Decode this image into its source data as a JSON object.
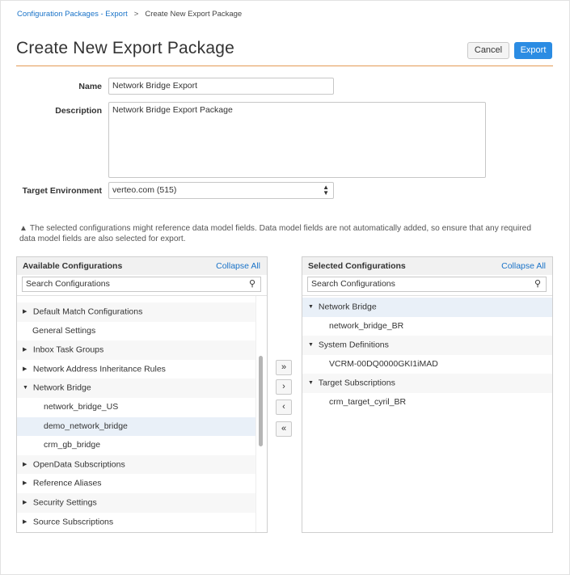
{
  "breadcrumb": {
    "parent": "Configuration Packages - Export",
    "separator": ">",
    "current": "Create New Export Package"
  },
  "page": {
    "title": "Create New Export Package"
  },
  "actions": {
    "cancel_label": "Cancel",
    "export_label": "Export"
  },
  "form": {
    "name_label": "Name",
    "name_value": "Network Bridge Export",
    "description_label": "Description",
    "description_value": "Network Bridge Export Package",
    "env_label": "Target Environment",
    "env_value": "verteo.com (515)"
  },
  "warning": {
    "icon": "warning-triangle-icon",
    "text": "The selected configurations might reference data model fields. Data model fields are not automatically added, so ensure that any required data model fields are also selected for export."
  },
  "available": {
    "title": "Available Configurations",
    "collapse_label": "Collapse All",
    "search_placeholder": "Search Configurations",
    "items": [
      {
        "label": "Default Match Configurations",
        "toggle": "▶",
        "level": 0
      },
      {
        "label": "General Settings",
        "toggle": "",
        "level": 0
      },
      {
        "label": "Inbox Task Groups",
        "toggle": "▶",
        "level": 0
      },
      {
        "label": "Network Address Inheritance Rules",
        "toggle": "▶",
        "level": 0
      },
      {
        "label": "Network Bridge",
        "toggle": "▼",
        "level": 0
      },
      {
        "label": "network_bridge_US",
        "toggle": "",
        "level": 1
      },
      {
        "label": "demo_network_bridge",
        "toggle": "",
        "level": 1,
        "selected": true
      },
      {
        "label": "crm_gb_bridge",
        "toggle": "",
        "level": 1
      },
      {
        "label": "OpenData Subscriptions",
        "toggle": "▶",
        "level": 0
      },
      {
        "label": "Reference Aliases",
        "toggle": "▶",
        "level": 0
      },
      {
        "label": "Security Settings",
        "toggle": "▶",
        "level": 0
      },
      {
        "label": "Source Subscriptions",
        "toggle": "▶",
        "level": 0
      }
    ]
  },
  "move_buttons": {
    "add_all": "»",
    "add": "›",
    "remove": "‹",
    "remove_all": "«"
  },
  "selected": {
    "title": "Selected Configurations",
    "collapse_label": "Collapse All",
    "search_placeholder": "Search Configurations",
    "items": [
      {
        "label": "Network Bridge",
        "toggle": "▼",
        "level": 0,
        "selected": true
      },
      {
        "label": "network_bridge_BR",
        "toggle": "",
        "level": 1
      },
      {
        "label": "System Definitions",
        "toggle": "▼",
        "level": 0
      },
      {
        "label": "VCRM-00DQ0000GKI1iMAD",
        "toggle": "",
        "level": 1
      },
      {
        "label": "Target Subscriptions",
        "toggle": "▼",
        "level": 0
      },
      {
        "label": "crm_target_cyril_BR",
        "toggle": "",
        "level": 1
      }
    ]
  }
}
